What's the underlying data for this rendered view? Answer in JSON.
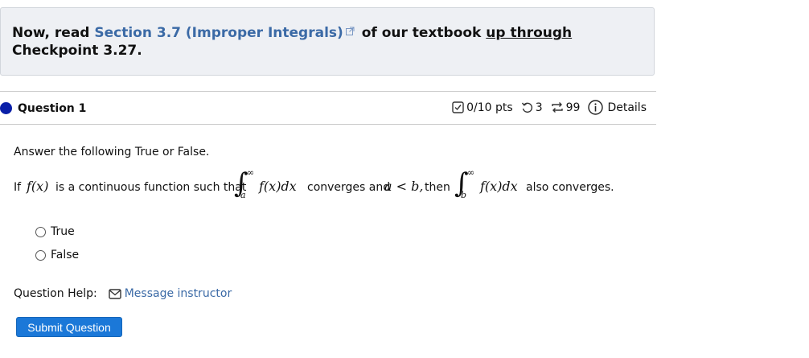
{
  "banner": {
    "prefix": "Now, read ",
    "link": "Section 3.7 (Improper Integrals)",
    "middle": " of our textbook ",
    "underlined": "up through",
    "suffix": " Checkpoint 3.27."
  },
  "question": {
    "title": "Question 1",
    "points": "0/10 pts",
    "attempts": "3",
    "retries": "99",
    "details_label": "Details",
    "prompt": "Answer the following True or False.",
    "statement": {
      "if_text": "If",
      "fx": "f(x)",
      "mid_text": "is a continuous function such that",
      "int1_upper": "∞",
      "int1_lower": "a",
      "integrand1": "f(x)dx",
      "converges_text": "converges and",
      "condition": "a < b,",
      "then_text": "then",
      "int2_upper": "∞",
      "int2_lower": "b",
      "integrand2": "f(x)dx",
      "end_text": "also converges."
    },
    "options": [
      "True",
      "False"
    ],
    "help_label": "Question Help:",
    "message_label": "Message instructor",
    "submit_label": "Submit Question"
  },
  "colors": {
    "link": "#3b6aa6",
    "submit": "#1b78d8",
    "dot": "#0a1fa8"
  }
}
